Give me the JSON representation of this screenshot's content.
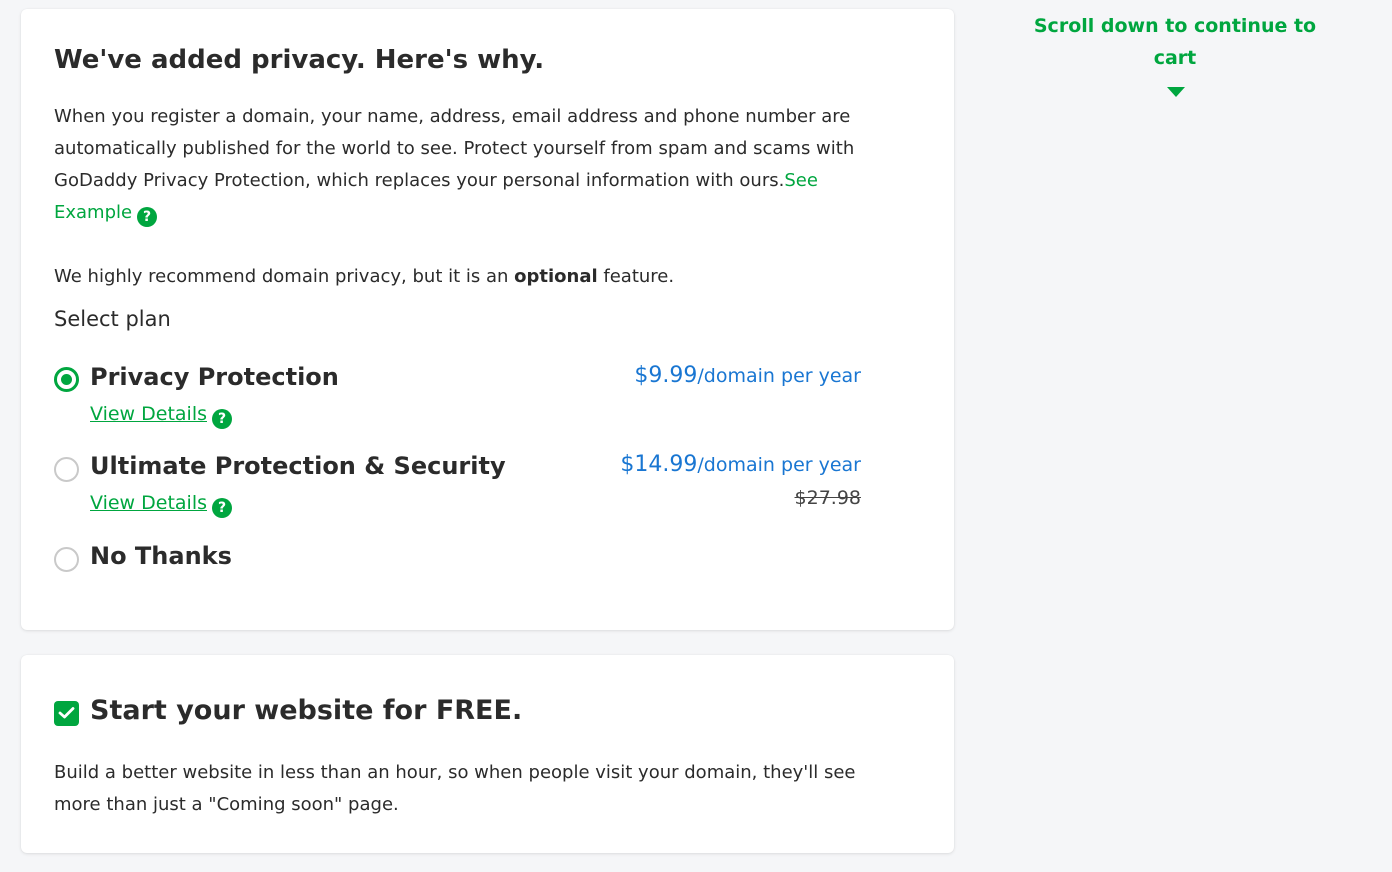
{
  "privacy": {
    "title": "We've added privacy. Here's why.",
    "description": "When you register a domain, your name, address, email address and phone number are automatically published for the world to see. Protect yourself from spam and scams with GoDaddy Privacy Protection, which replaces your personal information with ours.",
    "see_example_label": "See Example",
    "recommend_prefix": "We highly recommend domain privacy, but it is an ",
    "recommend_bold": "optional",
    "recommend_suffix": " feature.",
    "select_plan_label": "Select plan",
    "help_glyph": "?",
    "plans": [
      {
        "name": "Privacy Protection",
        "price": "$9.99",
        "per": "/domain per year",
        "details_label": "View Details",
        "selected": true
      },
      {
        "name": "Ultimate Protection & Security",
        "price": "$14.99",
        "per": "/domain per year",
        "old_price": "$27.98",
        "details_label": "View Details",
        "selected": false
      },
      {
        "name": "No Thanks",
        "selected": false
      }
    ]
  },
  "website": {
    "title": "Start your website for FREE.",
    "checked": true,
    "description": "Build a better website in less than an hour, so when people visit your domain, they'll see more than just a \"Coming soon\" page."
  },
  "scroll_hint": {
    "text": "Scroll down to continue to cart",
    "icon": "triangle-down-icon"
  },
  "colors": {
    "accent_green": "#00a63f",
    "price_blue": "#1976d2",
    "background": "#f5f6f8"
  }
}
